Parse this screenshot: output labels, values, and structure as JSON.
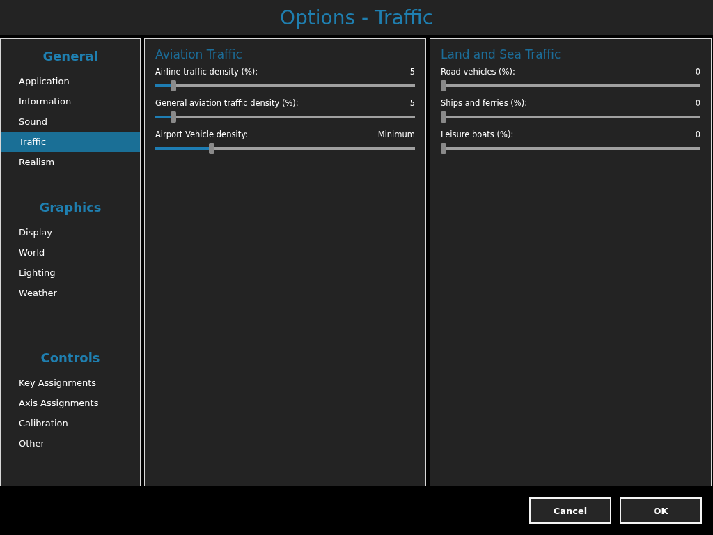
{
  "window": {
    "title": "Options - Traffic"
  },
  "sidebar": {
    "groups": [
      {
        "title": "General",
        "items": [
          {
            "label": "Application",
            "selected": false
          },
          {
            "label": "Information",
            "selected": false
          },
          {
            "label": "Sound",
            "selected": false
          },
          {
            "label": "Traffic",
            "selected": true
          },
          {
            "label": "Realism",
            "selected": false
          }
        ]
      },
      {
        "title": "Graphics",
        "items": [
          {
            "label": "Display",
            "selected": false
          },
          {
            "label": "World",
            "selected": false
          },
          {
            "label": "Lighting",
            "selected": false
          },
          {
            "label": "Weather",
            "selected": false
          }
        ]
      },
      {
        "title": "Controls",
        "items": [
          {
            "label": "Key Assignments",
            "selected": false
          },
          {
            "label": "Axis Assignments",
            "selected": false
          },
          {
            "label": "Calibration",
            "selected": false
          },
          {
            "label": "Other",
            "selected": false
          }
        ]
      }
    ]
  },
  "panels": [
    {
      "title": "Aviation Traffic",
      "settings": [
        {
          "label": "Airline traffic density (%):",
          "reading": "5",
          "level": 0.06
        },
        {
          "label": "General aviation traffic density (%):",
          "reading": "5",
          "level": 0.06
        },
        {
          "label": "Airport Vehicle density:",
          "reading": "Minimum",
          "level": 0.21
        }
      ]
    },
    {
      "title": "Land and Sea Traffic",
      "settings": [
        {
          "label": "Road vehicles (%):",
          "reading": "0",
          "level": 0
        },
        {
          "label": "Ships and ferries (%):",
          "reading": "0",
          "level": 0
        },
        {
          "label": "Leisure boats (%):",
          "reading": "0",
          "level": 0
        }
      ]
    }
  ],
  "buttons": [
    "Cancel",
    "OK"
  ]
}
